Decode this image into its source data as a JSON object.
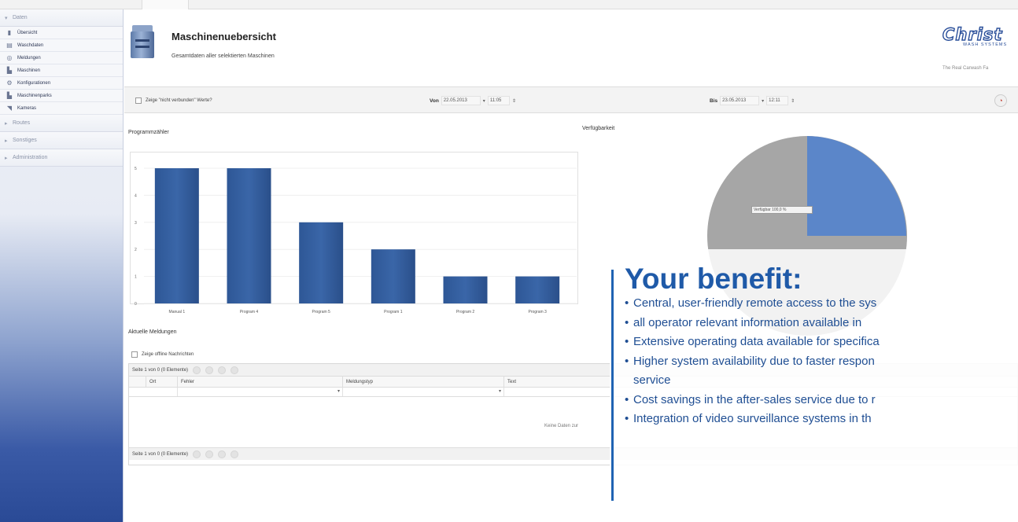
{
  "sidebar": {
    "groups": [
      {
        "label": "Daten",
        "arrow": "▾"
      },
      {
        "label": "Routes",
        "arrow": "▸"
      },
      {
        "label": "Sonstiges",
        "arrow": "▸"
      },
      {
        "label": "Administration",
        "arrow": "▸"
      }
    ],
    "items": [
      {
        "label": "Übersicht",
        "icon": "chart-icon"
      },
      {
        "label": "Waschdaten",
        "icon": "table-icon"
      },
      {
        "label": "Meldungen",
        "icon": "messages-icon"
      },
      {
        "label": "Maschinen",
        "icon": "machine-icon"
      },
      {
        "label": "Konfigurationen",
        "icon": "config-icon"
      },
      {
        "label": "Maschinenparks",
        "icon": "machine-park-icon"
      },
      {
        "label": "Kameras",
        "icon": "camera-icon"
      }
    ]
  },
  "header": {
    "title": "Maschinenuebersicht",
    "subtitle": "Gesamtdaten aller selektierten Maschinen",
    "logo_text": "Christ",
    "logo_sub": "WASH SYSTEMS",
    "tagline": "The Real Carwash Fa"
  },
  "filter": {
    "show_unconnected_label": "Zeige \"nicht verbunden\" Werte?",
    "from_label": "Von",
    "from_date": "22.05.2013",
    "from_time": "11:05",
    "to_label": "Bis",
    "to_date": "23.05.2013",
    "to_time": "12:11"
  },
  "sections": {
    "program_counter": "Programmzähler",
    "availability": "Verfügbarkeit",
    "current_messages": "Aktuelle Meldungen"
  },
  "chart_data": {
    "type": "bar",
    "title": "Programmzähler",
    "categories": [
      "Manual 1",
      "Program 4",
      "Program 5",
      "Program 1",
      "Program 2",
      "Program 3"
    ],
    "values": [
      5,
      5,
      3,
      2,
      1,
      1
    ],
    "ylim": [
      0,
      5
    ],
    "yticks": [
      "0",
      "1",
      "2",
      "3",
      "4",
      "5"
    ],
    "color": "#3a66a8"
  },
  "pie": {
    "label": "Verfügbar 100,0 %",
    "main_color": "#a6a6a6",
    "slice_color": "#5b86c9"
  },
  "messages": {
    "show_offline_label": "Zeige offline Nachrichten",
    "pager_text": "Seite 1 von 0 (0 Elemente)",
    "columns": [
      "Ort",
      "Fehler",
      "Meldungstyp",
      "Text"
    ],
    "no_data": "Keine Daten zur"
  },
  "benefit": {
    "title": "Your benefit:",
    "bullet": "•",
    "items": [
      "Central, user-friendly remote access to the sys",
      "all operator relevant information available in",
      "Extensive operating data available for specifica",
      "Higher system availability due to faster respon",
      "service",
      "Cost savings in the after-sales service due to r",
      "Integration of video surveillance systems in th"
    ]
  }
}
